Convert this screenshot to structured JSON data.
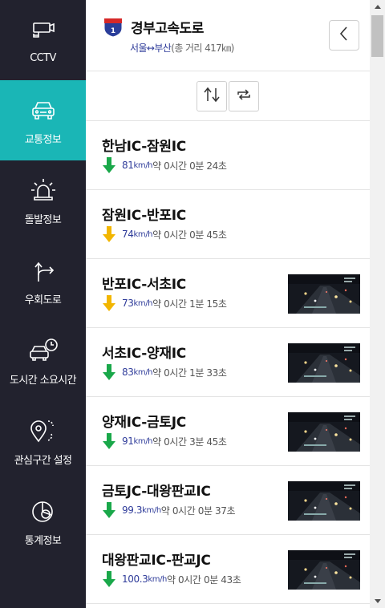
{
  "sidebar": {
    "items": [
      {
        "label": "CCTV",
        "icon": "cctv-icon",
        "active": false
      },
      {
        "label": "교통정보",
        "icon": "car-icon",
        "active": true
      },
      {
        "label": "돌발정보",
        "icon": "siren-icon",
        "active": false
      },
      {
        "label": "우회도로",
        "icon": "detour-icon",
        "active": false
      },
      {
        "label": "도시간 소요시간",
        "icon": "car-clock-icon",
        "active": false
      },
      {
        "label": "관심구간 설정",
        "icon": "location-pin-icon",
        "active": false
      },
      {
        "label": "통계정보",
        "icon": "pie-chart-icon",
        "active": false
      }
    ]
  },
  "route": {
    "shield_number": "1",
    "title": "경부고속도로",
    "from": "서울",
    "arrow": "↔",
    "to": "부산",
    "distance": "(총 거리 417㎞)"
  },
  "segments": [
    {
      "name": "한남IC-잠원IC",
      "speed": "81",
      "unit": "km/h",
      "eta": "약 0시간 0분 24초",
      "trend": "down",
      "camera": false
    },
    {
      "name": "잠원IC-반포IC",
      "speed": "74",
      "unit": "km/h",
      "eta": "약 0시간 0분 45초",
      "trend": "slow",
      "camera": false
    },
    {
      "name": "반포IC-서초IC",
      "speed": "73",
      "unit": "km/h",
      "eta": "약 0시간 1분 15초",
      "trend": "slow",
      "camera": true
    },
    {
      "name": "서초IC-양재IC",
      "speed": "83",
      "unit": "km/h",
      "eta": "약 0시간 1분 33초",
      "trend": "down",
      "camera": true
    },
    {
      "name": "양재IC-금토JC",
      "speed": "91",
      "unit": "km/h",
      "eta": "약 0시간 3분 45초",
      "trend": "down",
      "camera": true
    },
    {
      "name": "금토JC-대왕판교IC",
      "speed": "99.3",
      "unit": "km/h",
      "eta": "약 0시간 0분 37초",
      "trend": "down",
      "camera": true
    },
    {
      "name": "대왕판교IC-판교JC",
      "speed": "100.3",
      "unit": "km/h",
      "eta": "약 0시간 0분 43초",
      "trend": "down",
      "camera": true
    }
  ],
  "colors": {
    "sidebar_bg": "#22222e",
    "active_bg": "#1ab6b6",
    "speed_text": "#2f3c9a",
    "arrow_green": "#1aa84a",
    "arrow_yellow": "#f2b600"
  }
}
